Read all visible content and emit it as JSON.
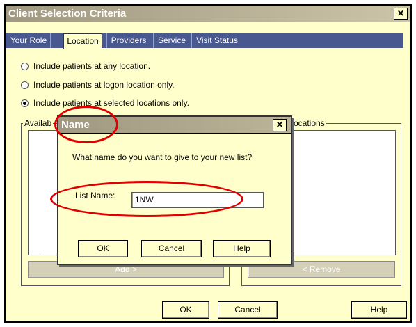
{
  "window": {
    "title": "Client Selection Criteria",
    "close_label": "×"
  },
  "tabs": [
    {
      "label": "Your Role",
      "active": false
    },
    {
      "label": "Location",
      "active": true
    },
    {
      "label": "Providers",
      "active": false
    },
    {
      "label": "Service",
      "active": false
    },
    {
      "label": "Visit Status",
      "active": false
    }
  ],
  "options": [
    {
      "label": "Include patients at any location.",
      "selected": false
    },
    {
      "label": "Include patients at logon location only.",
      "selected": false
    },
    {
      "label": "Include patients at selected locations only.",
      "selected": true
    }
  ],
  "groups": {
    "available_label": "Availab",
    "selected_label": "ocations"
  },
  "buttons": {
    "add": "Add >",
    "remove": "< Remove",
    "ok": "OK",
    "cancel": "Cancel",
    "help": "Help"
  },
  "dialog": {
    "title": "Name",
    "close_label": "×",
    "prompt": "What name do you want to give to your new list?",
    "field_label": "List Name:",
    "field_value": "1NW",
    "ok": "OK",
    "cancel": "Cancel",
    "help": "Help"
  },
  "colors": {
    "background": "#ffffcc",
    "tab_strip": "#4a5890",
    "annotation": "#e00000"
  }
}
